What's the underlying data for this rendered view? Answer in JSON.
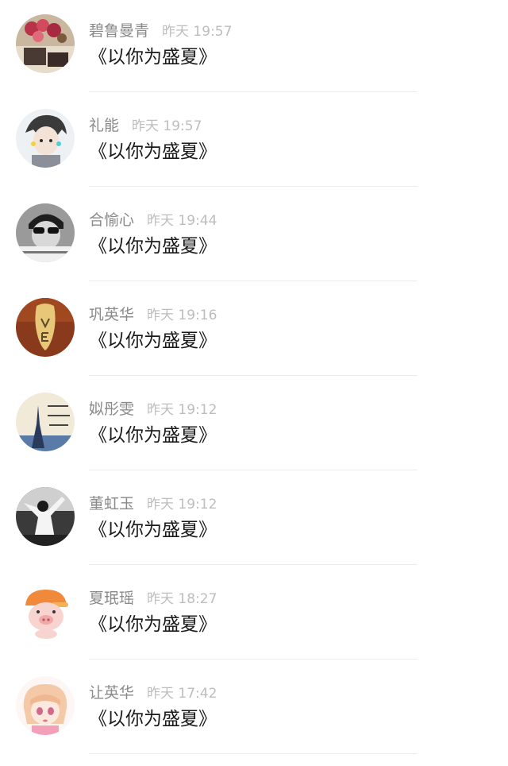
{
  "comments": [
    {
      "name": "碧鲁曼青",
      "time": "昨天 19:57",
      "content": "《以你为盛夏》",
      "avatar": "avatar-photo-flowers"
    },
    {
      "name": "礼能",
      "time": "昨天 19:57",
      "content": "《以你为盛夏》",
      "avatar": "avatar-anime-boy"
    },
    {
      "name": "合愉心",
      "time": "昨天 19:44",
      "content": "《以你为盛夏》",
      "avatar": "avatar-bw-sunglasses"
    },
    {
      "name": "巩英华",
      "time": "昨天 19:16",
      "content": "《以你为盛夏》",
      "avatar": "avatar-love-tag"
    },
    {
      "name": "姒彤雯",
      "time": "昨天 19:12",
      "content": "《以你为盛夏》",
      "avatar": "avatar-eiffel-tower"
    },
    {
      "name": "董虹玉",
      "time": "昨天 19:12",
      "content": "《以你为盛夏》",
      "avatar": "avatar-bw-figure"
    },
    {
      "name": "夏珉瑶",
      "time": "昨天 18:27",
      "content": "《以你为盛夏》",
      "avatar": "avatar-cartoon-pig"
    },
    {
      "name": "让英华",
      "time": "昨天 17:42",
      "content": "《以你为盛夏》",
      "avatar": "avatar-anime-girl"
    }
  ],
  "colors": {
    "name": "#8a8a8a",
    "time": "#bdbdbd",
    "content": "#1a1a1a",
    "divider": "#ececec"
  }
}
